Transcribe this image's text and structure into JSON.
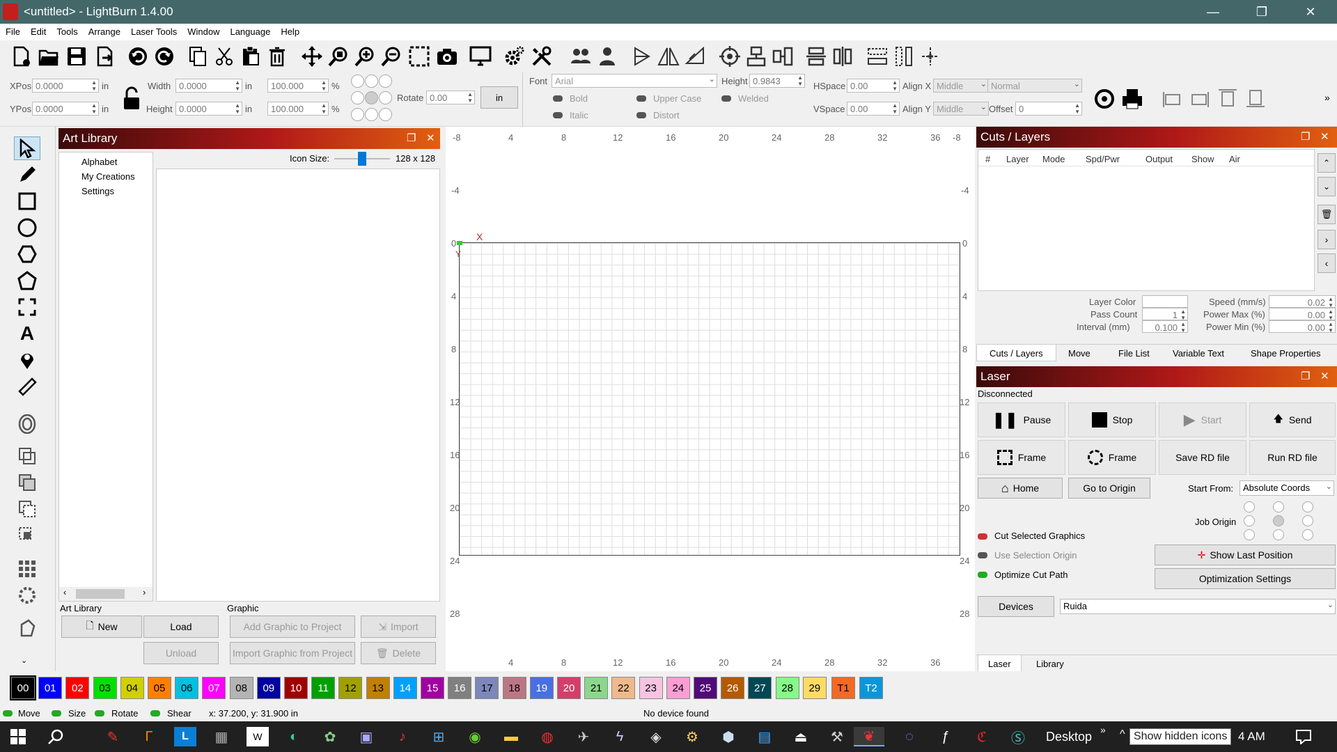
{
  "window": {
    "title": "<untitled> - LightBurn 1.4.00",
    "min": "—",
    "max": "❐",
    "close": "✕"
  },
  "menu": [
    "File",
    "Edit",
    "Tools",
    "Arrange",
    "Laser Tools",
    "Window",
    "Language",
    "Help"
  ],
  "numeric": {
    "xpos_label": "XPos",
    "xpos": "0.0000",
    "ypos_label": "YPos",
    "ypos": "0.0000",
    "unit": "in",
    "width_label": "Width",
    "width": "0.0000",
    "height_label": "Height",
    "height": "0.0000",
    "scale_x": "100.000",
    "scale_y": "100.000",
    "pct": "%",
    "rotate_label": "Rotate",
    "rotate": "0.00",
    "unit_button": "in"
  },
  "text_tools": {
    "font_label": "Font",
    "font": "Arial",
    "height_label": "Height",
    "height": "0.9843",
    "bold": "Bold",
    "italic": "Italic",
    "upper_case": "Upper Case",
    "distort": "Distort",
    "welded": "Welded",
    "hspace_label": "HSpace",
    "hspace": "0.00",
    "vspace_label": "VSpace",
    "vspace": "0.00",
    "alignx_label": "Align X",
    "alignx": "Middle",
    "aligny_label": "Align Y",
    "aligny": "Middle",
    "mode": "Normal",
    "offset_label": "Offset",
    "offset": "0"
  },
  "art_library": {
    "title": "Art Library",
    "libraries": [
      "Alphabet",
      "My Creations",
      "Settings"
    ],
    "icon_size_label": "Icon Size:",
    "icon_size": "128 x 128",
    "group_library": "Art Library",
    "group_graphic": "Graphic",
    "new": "New",
    "load": "Load",
    "unload": "Unload",
    "add_graphic": "Add Graphic to Project",
    "import": "Import",
    "import_graphic": "Import Graphic from Project",
    "delete": "Delete"
  },
  "ruler": {
    "top": [
      "4",
      "8",
      "12",
      "16",
      "20",
      "24",
      "28",
      "32",
      "36"
    ],
    "left": [
      "-4",
      "0",
      "4",
      "8",
      "12",
      "16",
      "20",
      "24",
      "28"
    ],
    "corner": "-8",
    "x_marker": "X",
    "y_marker": "Y"
  },
  "cuts_layers": {
    "title": "Cuts / Layers",
    "columns": [
      "#",
      "Layer",
      "Mode",
      "Spd/Pwr",
      "Output",
      "Show",
      "Air"
    ],
    "layer_color_label": "Layer Color",
    "pass_count_label": "Pass Count",
    "pass_count": "1",
    "interval_label": "Interval (mm)",
    "interval": "0.100",
    "speed_label": "Speed (mm/s)",
    "speed": "0.02",
    "power_max_label": "Power Max (%)",
    "power_max": "0.00",
    "power_min_label": "Power Min (%)",
    "power_min": "0.00",
    "tabs": [
      "Cuts / Layers",
      "Move",
      "File List",
      "Variable Text",
      "Shape Properties"
    ]
  },
  "laser": {
    "title": "Laser",
    "status": "Disconnected",
    "pause": "Pause",
    "stop": "Stop",
    "start": "Start",
    "send": "Send",
    "frame1": "Frame",
    "frame2": "Frame",
    "save_rd": "Save RD file",
    "run_rd": "Run RD file",
    "home": "Home",
    "go_origin": "Go to Origin",
    "start_from_label": "Start From:",
    "start_from": "Absolute Coords",
    "job_origin_label": "Job Origin",
    "cut_selected": "Cut Selected Graphics",
    "use_selection_origin": "Use Selection Origin",
    "optimize": "Optimize Cut Path",
    "show_last": "Show Last Position",
    "opt_settings": "Optimization Settings",
    "devices": "Devices",
    "device": "Ruida",
    "tabs": [
      "Laser",
      "Library"
    ]
  },
  "palette": [
    {
      "n": "00",
      "c": "#000000",
      "t": "#ffffff"
    },
    {
      "n": "01",
      "c": "#0000ff",
      "t": "#ffffff"
    },
    {
      "n": "02",
      "c": "#ff0000",
      "t": "#ffffff"
    },
    {
      "n": "03",
      "c": "#00e000",
      "t": "#000000"
    },
    {
      "n": "04",
      "c": "#d0d000",
      "t": "#000000"
    },
    {
      "n": "05",
      "c": "#ff8000",
      "t": "#000000"
    },
    {
      "n": "06",
      "c": "#00c0e0",
      "t": "#000000"
    },
    {
      "n": "07",
      "c": "#ff00ff",
      "t": "#ffffff"
    },
    {
      "n": "08",
      "c": "#b4b4b4",
      "t": "#000000"
    },
    {
      "n": "09",
      "c": "#0000a0",
      "t": "#ffffff"
    },
    {
      "n": "10",
      "c": "#a00000",
      "t": "#ffffff"
    },
    {
      "n": "11",
      "c": "#00a000",
      "t": "#ffffff"
    },
    {
      "n": "12",
      "c": "#a0a000",
      "t": "#000000"
    },
    {
      "n": "13",
      "c": "#c08000",
      "t": "#000000"
    },
    {
      "n": "14",
      "c": "#00a0ff",
      "t": "#ffffff"
    },
    {
      "n": "15",
      "c": "#a000a0",
      "t": "#ffffff"
    },
    {
      "n": "16",
      "c": "#808080",
      "t": "#ffffff"
    },
    {
      "n": "17",
      "c": "#7d87b9",
      "t": "#000000"
    },
    {
      "n": "18",
      "c": "#bb7784",
      "t": "#000000"
    },
    {
      "n": "19",
      "c": "#4a6fe3",
      "t": "#ffffff"
    },
    {
      "n": "20",
      "c": "#d33f6a",
      "t": "#ffffff"
    },
    {
      "n": "21",
      "c": "#8cd78c",
      "t": "#000000"
    },
    {
      "n": "22",
      "c": "#f0b98d",
      "t": "#000000"
    },
    {
      "n": "23",
      "c": "#f6c4e1",
      "t": "#000000"
    },
    {
      "n": "24",
      "c": "#fa9ed4",
      "t": "#000000"
    },
    {
      "n": "25",
      "c": "#500a78",
      "t": "#ffffff"
    },
    {
      "n": "26",
      "c": "#b45a00",
      "t": "#ffffff"
    },
    {
      "n": "27",
      "c": "#004754",
      "t": "#ffffff"
    },
    {
      "n": "28",
      "c": "#86fa88",
      "t": "#000000"
    },
    {
      "n": "29",
      "c": "#ffdb66",
      "t": "#000000"
    },
    {
      "n": "T1",
      "c": "#f36926",
      "t": "#000000"
    },
    {
      "n": "T2",
      "c": "#0c96d9",
      "t": "#ffffff"
    }
  ],
  "status": {
    "move": "Move",
    "size": "Size",
    "rotate": "Rotate",
    "shear": "Shear",
    "coords": "x: 37.200, y: 31.900 in",
    "device": "No device found"
  },
  "taskbar": {
    "desktop": "Desktop",
    "tooltip": "Show hidden icons",
    "time": "4 AM"
  }
}
